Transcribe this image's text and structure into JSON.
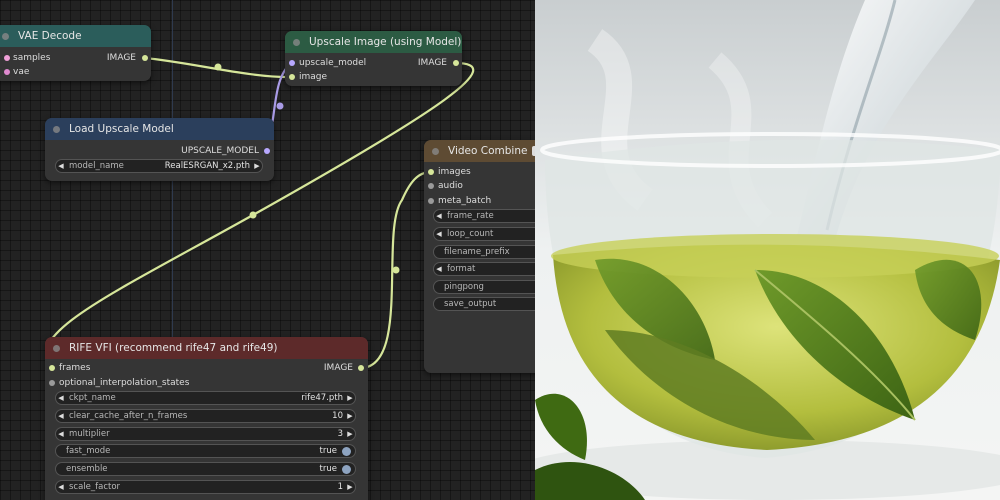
{
  "colors": {
    "canvas_bg": "#222222",
    "node_bg": "#353535",
    "wire_image": "#d6e69a",
    "wire_model": "#a99be6",
    "slot_image": "#d6e69a",
    "slot_latent": "#f0a0d8",
    "slot_vae": "#e08ad0",
    "slot_model": "#b8a8ff",
    "slot_gray": "#9a9a9a"
  },
  "nodes": {
    "vae_decode": {
      "title": "VAE Decode",
      "header_color": "#2b5d5b",
      "inputs": [
        "samples",
        "vae"
      ],
      "output": "IMAGE"
    },
    "upscale_image": {
      "title": "Upscale Image (using Model)",
      "header_color": "#2c5b43",
      "inputs": [
        "upscale_model",
        "image"
      ],
      "output": "IMAGE"
    },
    "load_upscale_model": {
      "title": "Load Upscale Model",
      "header_color": "#2b3f5c",
      "output": "UPSCALE_MODEL",
      "widgets": [
        {
          "label": "model_name",
          "value": "RealESRGAN_x2.pth"
        }
      ]
    },
    "video_combine": {
      "title": "Video Combine",
      "header_color": "#5e4b33",
      "header_icon": "video-combine-emoji-icon",
      "inputs": [
        "images",
        "audio",
        "meta_batch"
      ],
      "widgets": [
        {
          "label": "frame_rate",
          "type": "number"
        },
        {
          "label": "loop_count",
          "type": "number"
        },
        {
          "label": "filename_prefix",
          "type": "text"
        },
        {
          "label": "format",
          "type": "combo"
        },
        {
          "label": "pingpong",
          "type": "toggle"
        },
        {
          "label": "save_output",
          "type": "toggle"
        }
      ]
    },
    "rife_vfi": {
      "title": "RIFE VFI (recommend rife47 and rife49)",
      "header_color": "#5d2a2a",
      "inputs": [
        "frames",
        "optional_interpolation_states"
      ],
      "output": "IMAGE",
      "widgets": [
        {
          "label": "ckpt_name",
          "value": "rife47.pth",
          "type": "combo"
        },
        {
          "label": "clear_cache_after_n_frames",
          "value": "10",
          "type": "number"
        },
        {
          "label": "multiplier",
          "value": "3",
          "type": "number"
        },
        {
          "label": "fast_mode",
          "value": "true",
          "type": "toggle"
        },
        {
          "label": "ensemble",
          "value": "true",
          "type": "toggle"
        },
        {
          "label": "scale_factor",
          "value": "1",
          "type": "number"
        }
      ]
    }
  },
  "photo": {
    "subject": "green-tea-cup-pour",
    "colors": {
      "bg": "#e9eceb",
      "tea": "#a9b63a",
      "leaf": "#4f7a1c",
      "water": "#dfe7ea"
    }
  }
}
